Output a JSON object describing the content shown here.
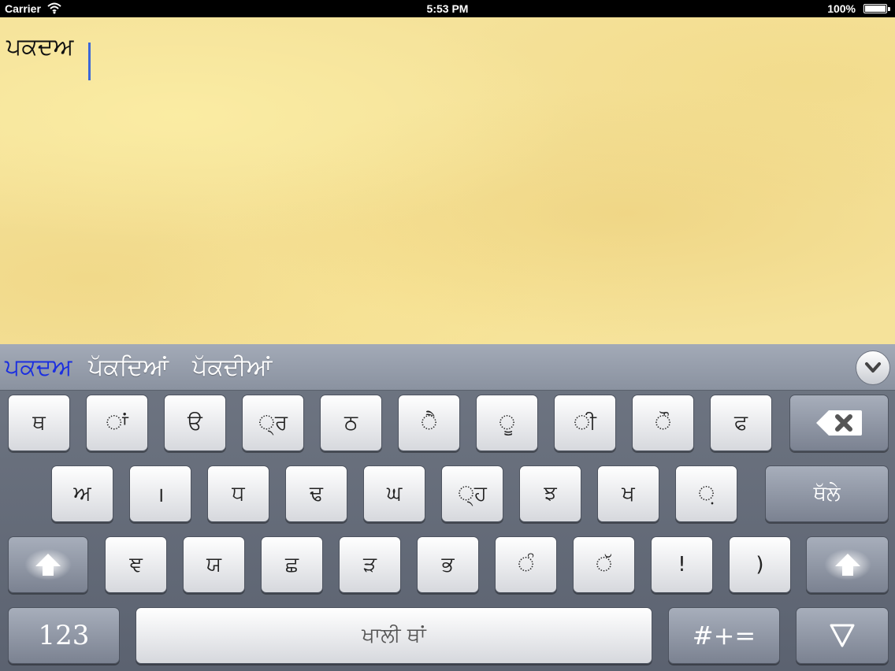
{
  "status_bar": {
    "carrier": "Carrier",
    "time": "5:53 PM",
    "battery": "100%",
    "wifi_icon": "wifi-icon",
    "battery_icon": "battery-icon"
  },
  "editor": {
    "text": "ਪਕਦਅ"
  },
  "suggestions": {
    "items": [
      "ਪਕਦਅ",
      "ਪੱਕਦਿਆਂ",
      "ਪੱਕਦੀਆਂ"
    ],
    "collapse_icon": "chevron-down-icon"
  },
  "keyboard": {
    "row1": [
      "ਥ",
      "ਾਂ",
      "ੳ",
      "੍ਰ",
      "ਠ",
      "ੈ",
      "ੂ",
      "ੀ",
      "ੌ",
      "ਫ"
    ],
    "row1_delete_icon": "delete-icon",
    "row2": [
      "ਅ",
      "।",
      "ਧ",
      "ਢ",
      "ਘ",
      "੍ਹ",
      "ਝ",
      "ਖ",
      "਼"
    ],
    "row2_return": "ਥੱਲੇ",
    "row3_shift_icon": "shift-icon",
    "row3": [
      "ਞ",
      "ਯ",
      "ਛ",
      "ੜ",
      "ਭ",
      "ੰ",
      "ੱ",
      "!",
      ")"
    ],
    "row4_numbers": "123",
    "row4_space": "ਖਾਲੀ ਥਾਂ",
    "row4_symbols": "#+=",
    "row4_hide_icon": "hide-keyboard-icon"
  }
}
